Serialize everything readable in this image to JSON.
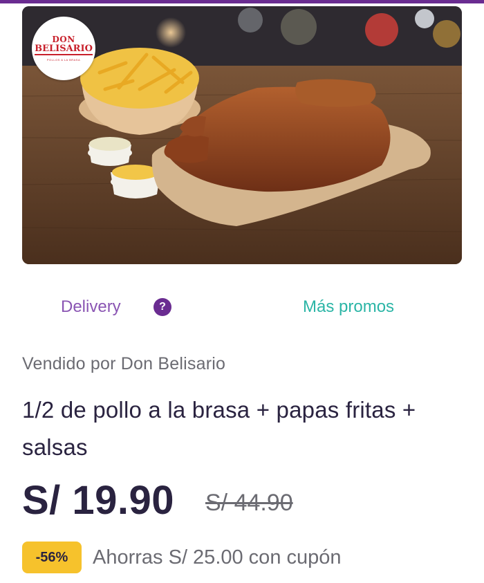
{
  "product": {
    "image_logo": {
      "line1": "DON",
      "line2": "BELISARIO",
      "line3": "POLLOS A LA BRASA"
    },
    "delivery_label": "Delivery",
    "help_icon": "?",
    "more_promos_label": "Más promos",
    "seller": "Vendido por Don Belisario",
    "title": "1/2 de pollo a la brasa + papas fritas + salsas",
    "price": "S/ 19.90",
    "old_price": "S/ 44.90",
    "discount": "-56%",
    "savings": "Ahorras S/ 25.00 con cupón"
  },
  "colors": {
    "brand_purple": "#6a2c91",
    "link_purple": "#8a55b3",
    "link_teal": "#2bb5a6",
    "badge_yellow": "#f6c22c",
    "text_dark": "#2a2340",
    "text_muted": "#6b6b72"
  }
}
